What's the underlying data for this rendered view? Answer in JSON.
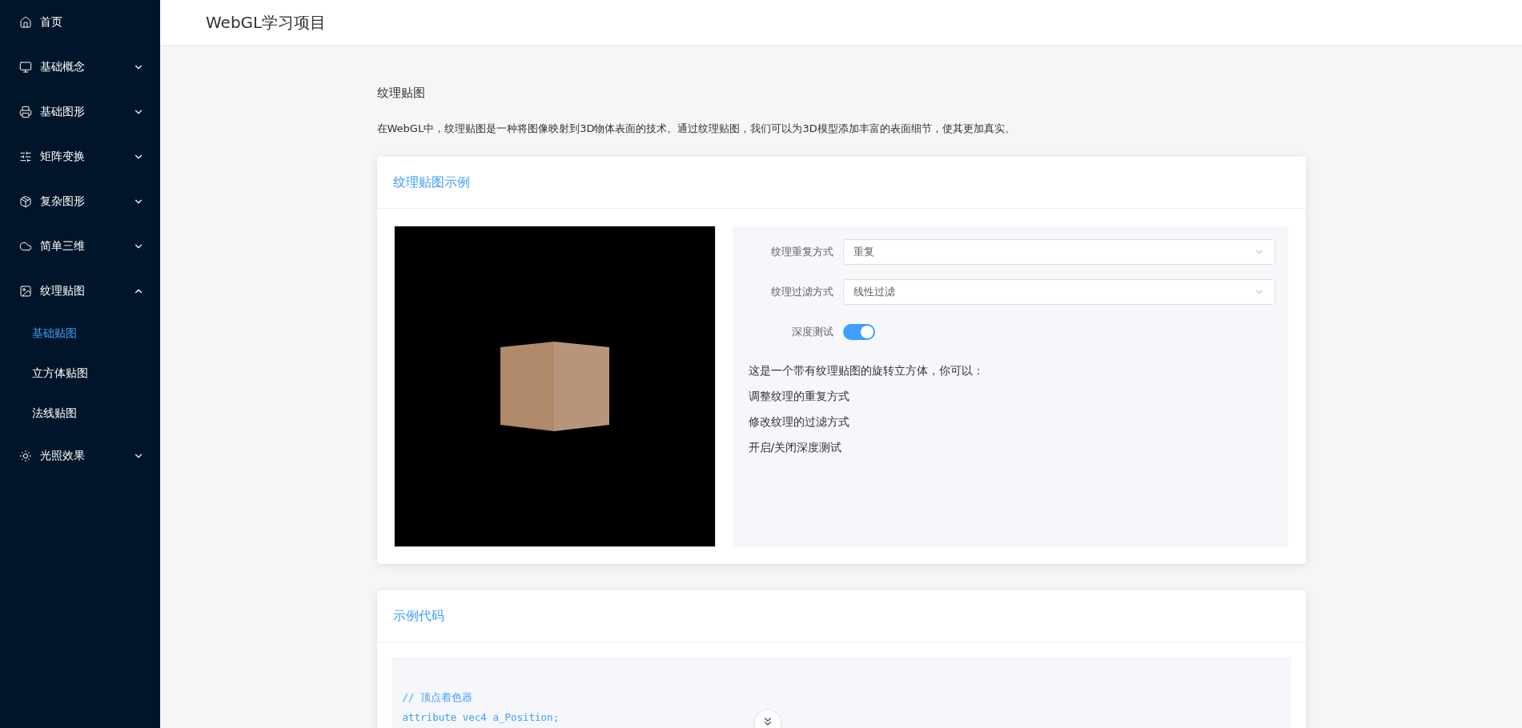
{
  "header": {
    "title": "WebGL学习项目"
  },
  "sidebar": {
    "items": [
      {
        "label": "首页",
        "kind": "link"
      },
      {
        "label": "基础概念",
        "kind": "submenu",
        "expanded": false
      },
      {
        "label": "基础图形",
        "kind": "submenu",
        "expanded": false
      },
      {
        "label": "矩阵变换",
        "kind": "submenu",
        "expanded": false
      },
      {
        "label": "复杂图形",
        "kind": "submenu",
        "expanded": false
      },
      {
        "label": "简单三维",
        "kind": "submenu",
        "expanded": false
      },
      {
        "label": "纹理贴图",
        "kind": "submenu",
        "expanded": true,
        "children": [
          {
            "label": "基础贴图",
            "selected": true
          },
          {
            "label": "立方体贴图",
            "selected": false
          },
          {
            "label": "法线贴图",
            "selected": false
          }
        ]
      },
      {
        "label": "光照效果",
        "kind": "submenu",
        "expanded": false
      }
    ]
  },
  "page": {
    "title": "纹理贴图",
    "intro": "在WebGL中，纹理贴图是一种将图像映射到3D物体表面的技术。通过纹理贴图，我们可以为3D模型添加丰富的表面细节，使其更加真实。"
  },
  "demo_card": {
    "title": "纹理贴图示例",
    "controls": [
      {
        "kind": "select",
        "label": "纹理重复方式",
        "value": "重复"
      },
      {
        "kind": "select",
        "label": "纹理过滤方式",
        "value": "线性过滤"
      },
      {
        "kind": "switch",
        "label": "深度测试",
        "on": true
      }
    ],
    "notes": [
      "这是一个带有纹理贴图的旋转立方体，你可以：",
      "调整纹理的重复方式",
      "修改纹理的过滤方式",
      "开启/关闭深度测试"
    ]
  },
  "code_card": {
    "title": "示例代码",
    "lines": [
      "// 顶点着色器",
      "attribute vec4 a_Position;"
    ]
  }
}
